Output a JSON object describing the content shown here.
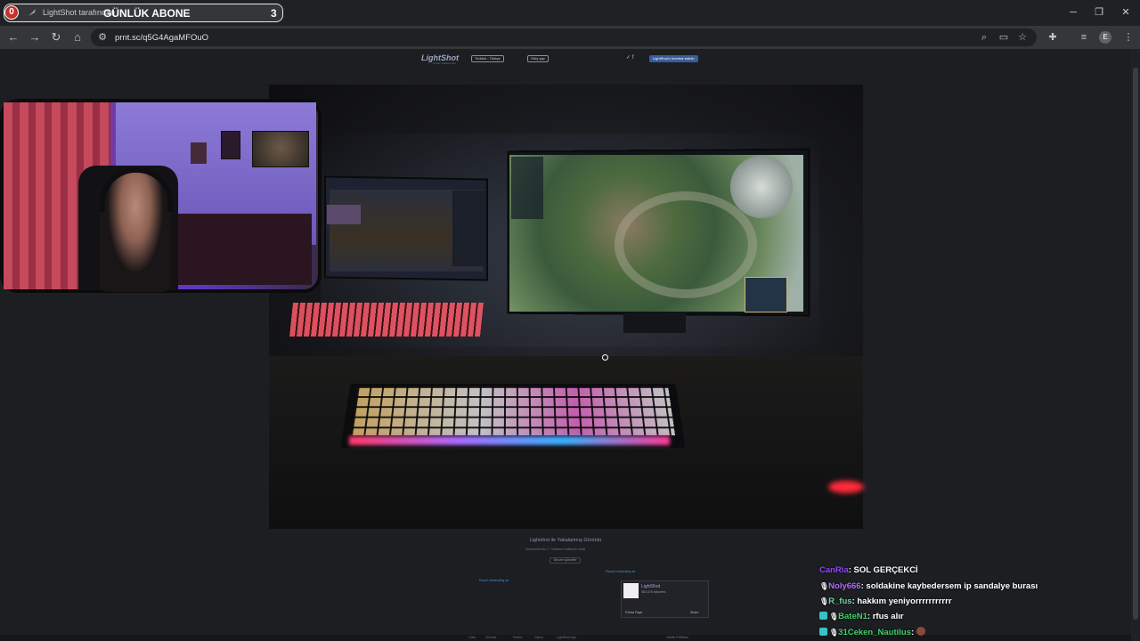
{
  "browser": {
    "tab_title": "LightShot tarafından",
    "url": "prnt.sc/q5G4AgaMFOuO",
    "profile_initial": "E"
  },
  "goal_overlay": {
    "current": "0",
    "label": "GÜNLÜK ABONE",
    "target": "3"
  },
  "lightshot": {
    "logo": "LightShot",
    "logo_sub": "screen capture tool",
    "language_pill": "Turkish - Türkçe",
    "login_pill": "Giriş yap",
    "social_icons": "✓ f",
    "install_button": "LightShot'u ücretsiz edinin",
    "caption": "Lightshot ile Yakalanmış Görüntü",
    "caption_links": "Screenshot No.1   ·   Kullanıcı Kaliteyon Geldi",
    "similar_button": "Benzer görseller",
    "report_link_1": "Report misleading ad",
    "report_link_2": "Report misleading ad",
    "fb_name": "LightShot",
    "fb_followers": "583,476 followers",
    "fb_follow": "Follow Page",
    "fb_share": "Share",
    "footer_links": [
      "Links",
      "Chrome",
      "Firefox",
      "Opera",
      "LightShot App"
    ],
    "footer_right": "Gizlilik Politikası"
  },
  "chat": [
    {
      "user": "CanRia",
      "color": "#9146ff",
      "message": "SOL GERÇEKCİ",
      "badge": ""
    },
    {
      "user": "Noly666",
      "color": "#b06bff",
      "message": "soldakine kaybedersem ip sandalye burası",
      "badge": "🎙"
    },
    {
      "user": "R_fus",
      "color": "#6fd6a0",
      "message": "hakkım yeniyorrrrrrrrrrr",
      "badge": "🎙"
    },
    {
      "user": "BateN1",
      "color": "#3ecf6a",
      "message": "rfus alır",
      "badge": "#35c4c4"
    },
    {
      "user": "31Ceken_Nautilus",
      "color": "#3ecf6a",
      "message": "",
      "badge": "#35c4c4"
    }
  ],
  "colors": {
    "page_bg": "#1c1e22",
    "accent_link": "#4f8ad8",
    "goal_badge": "#c9302c"
  }
}
